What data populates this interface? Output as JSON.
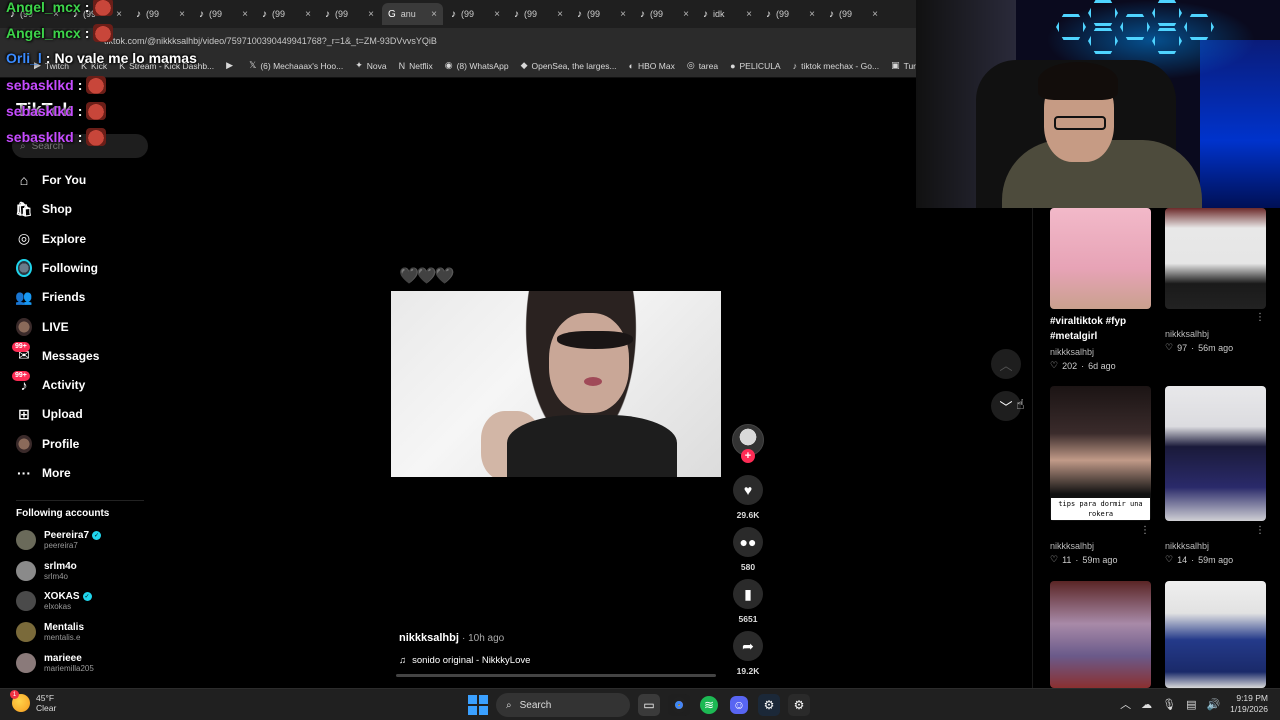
{
  "browser": {
    "tabs": [
      {
        "label": "(99"
      },
      {
        "label": "(99"
      },
      {
        "label": "(99"
      },
      {
        "label": "(99"
      },
      {
        "label": "(99"
      },
      {
        "label": "(99"
      },
      {
        "label": "anu"
      },
      {
        "label": "(99"
      },
      {
        "label": "(99"
      },
      {
        "label": "(99"
      },
      {
        "label": "(99"
      },
      {
        "label": "idk"
      },
      {
        "label": "(99"
      },
      {
        "label": "(99"
      }
    ],
    "url": "tiktok.com/@nikkksalhbj/video/7597100390449941768?_r=1&_t=ZM-93DVvvsYQiB",
    "bookmarks": [
      {
        "icon": "▶",
        "label": "Twitch"
      },
      {
        "icon": "K",
        "label": "Kick"
      },
      {
        "icon": "K",
        "label": "Stream - Kick Dashb..."
      },
      {
        "icon": "▶",
        "label": ""
      },
      {
        "icon": "𝕏",
        "label": "(6) Mechaaax's Hoo..."
      },
      {
        "icon": "✦",
        "label": "Nova"
      },
      {
        "icon": "N",
        "label": "Netflix"
      },
      {
        "icon": "◉",
        "label": "(8) WhatsApp"
      },
      {
        "icon": "◆",
        "label": "OpenSea, the larges..."
      },
      {
        "icon": "◐",
        "label": "HBO Max"
      },
      {
        "icon": "◎",
        "label": "tarea"
      },
      {
        "icon": "●",
        "label": "PELICULA"
      },
      {
        "icon": "♪",
        "label": "tiktok mechax - Go..."
      },
      {
        "icon": "▣",
        "label": "Turi"
      }
    ]
  },
  "chat": [
    {
      "user": "Angel_mcx",
      "text": "",
      "color": "#3dd44a"
    },
    {
      "user": "Angel_mcx",
      "text": "",
      "color": "#3dd44a"
    },
    {
      "user": "Orli_l",
      "text": "No vale me lo mamas",
      "color": "#3a8bff"
    },
    {
      "user": "sebasklkd",
      "text": "",
      "color": "#c64bff"
    },
    {
      "user": "sebasklkd",
      "text": "",
      "color": "#c64bff"
    },
    {
      "user": "sebasklkd",
      "text": "",
      "color": "#c64bff"
    }
  ],
  "sidebar": {
    "logo": "TikTok",
    "search_placeholder": "Search",
    "nav": [
      {
        "label": "For You",
        "icon": "home-icon"
      },
      {
        "label": "Shop",
        "icon": "shop-icon"
      },
      {
        "label": "Explore",
        "icon": "compass-icon"
      },
      {
        "label": "Following",
        "icon": "following-avatar-icon"
      },
      {
        "label": "Friends",
        "icon": "friends-icon"
      },
      {
        "label": "LIVE",
        "icon": "live-icon"
      },
      {
        "label": "Messages",
        "icon": "messages-icon",
        "badge": "99+"
      },
      {
        "label": "Activity",
        "icon": "activity-icon",
        "badge": "99+"
      },
      {
        "label": "Upload",
        "icon": "upload-icon"
      },
      {
        "label": "Profile",
        "icon": "profile-icon"
      },
      {
        "label": "More",
        "icon": "more-icon"
      }
    ],
    "following_title": "Following accounts",
    "accounts": [
      {
        "name": "Peereira7",
        "handle": "peereira7",
        "verified": true
      },
      {
        "name": "srlm4o",
        "handle": "srlm4o",
        "verified": false
      },
      {
        "name": "XOKAS",
        "handle": "elxokas",
        "verified": true
      },
      {
        "name": "Mentalis",
        "handle": "mentalis.e",
        "verified": false
      },
      {
        "name": "marieee",
        "handle": "mariemilla205",
        "verified": false
      }
    ]
  },
  "video": {
    "hearts": "🖤🖤🖤",
    "username": "nikkksalhbj",
    "time_ago": "· 10h ago",
    "music": "sonido original - NikkkyLove",
    "actions": {
      "likes": "29.6K",
      "comments": "580",
      "saves": "5651",
      "shares": "19.2K"
    }
  },
  "grid": {
    "cards": [
      {
        "title": "#viraltiktok #fyp #metalgirl",
        "user": "nikkksalhbj",
        "likes": "202",
        "ago": "6d ago"
      },
      {
        "title": "",
        "user": "nikkksalhbj",
        "likes": "97",
        "ago": "56m ago"
      },
      {
        "title": "",
        "user": "nikkksalhbj",
        "likes": "11",
        "ago": "59m ago",
        "overlay": "tips para dormir una rokera"
      },
      {
        "title": "",
        "user": "nikkksalhbj",
        "likes": "14",
        "ago": "59m ago"
      }
    ]
  },
  "taskbar": {
    "temp": "45°F",
    "condition": "Clear",
    "search": "Search",
    "time": "9:19 PM",
    "date": "1/19/2026"
  },
  "colors": {
    "tiktok_red": "#fe2c55",
    "tiktok_cyan": "#20d5ec"
  }
}
